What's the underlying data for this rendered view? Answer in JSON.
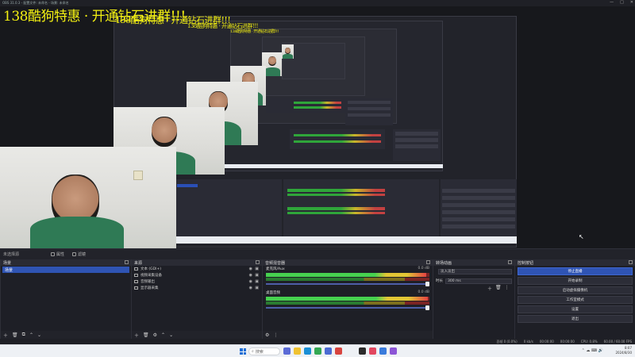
{
  "window": {
    "title": "OBS 31.0.3 - 配置文件: 未命名 - 场景: 未命名",
    "controls": [
      "—",
      "□",
      "✕"
    ]
  },
  "preview": {
    "overlay_title": "138酷狗特惠 · 开通钻石进群!!!",
    "cursor": "↖"
  },
  "scene_bar": {
    "label": "未选择源",
    "buttons": [
      {
        "label": "属性",
        "icon": "gear-icon"
      },
      {
        "label": "滤镜",
        "icon": "filter-icon"
      }
    ]
  },
  "scenes": {
    "header": "场景",
    "items": [
      "场景"
    ],
    "footer_icons": [
      "＋",
      "🗑",
      "⧉",
      "⌃",
      "⌄"
    ]
  },
  "sources": {
    "header": "来源",
    "items": [
      {
        "name": "文本 (GDI+)"
      },
      {
        "name": "视频采集设备"
      },
      {
        "name": "音频输出"
      },
      {
        "name": "显示器采集"
      }
    ],
    "footer_icons": [
      "＋",
      "🗑",
      "⚙",
      "⌃",
      "⌄"
    ]
  },
  "mixer": {
    "header": "音频混音器",
    "channels": [
      {
        "name": "麦克风/Aux",
        "db": "0.0 dB",
        "level": 0.98
      },
      {
        "name": "桌面音频",
        "db": "0.0 dB",
        "level": 0.99
      }
    ],
    "footer_icons": [
      "⚙",
      "⋮"
    ]
  },
  "transitions": {
    "header": "转场动画",
    "type_value": "淡入淡出",
    "duration_label": "时长",
    "duration_value": "300 ms"
  },
  "controls": {
    "header": "控制按钮",
    "buttons": [
      {
        "label": "停止直播",
        "primary": true
      },
      {
        "label": "开始录制",
        "primary": false
      },
      {
        "label": "启动虚拟摄像机",
        "primary": false
      },
      {
        "label": "工作室模式",
        "primary": false
      },
      {
        "label": "设置",
        "primary": false
      },
      {
        "label": "退出",
        "primary": false
      }
    ]
  },
  "status": {
    "frames": "丢帧 0 (0.0%)",
    "kbps": "0 kb/s",
    "live": "00:00:00",
    "rec": "00:00:00",
    "cpu": "CPU: 0.8%",
    "fps": "60.00 / 60.00 FPS"
  },
  "taskbar": {
    "search_placeholder": "搜索",
    "time": "8:07",
    "date": "2024/8/30",
    "apps": [
      {
        "name": "task-view",
        "color": "#5b6bd6"
      },
      {
        "name": "file-explorer",
        "color": "#f0c231"
      },
      {
        "name": "edge",
        "color": "#1a8fd6"
      },
      {
        "name": "chrome",
        "color": "#34a853"
      },
      {
        "name": "store",
        "color": "#4b6bd3"
      },
      {
        "name": "app-red",
        "color": "#d8443f"
      },
      {
        "name": "obs",
        "color": "#2b2b2b"
      },
      {
        "name": "app-pink",
        "color": "#e2475f"
      },
      {
        "name": "app-blue",
        "color": "#3a7bdc"
      },
      {
        "name": "app-purple",
        "color": "#8c55d6"
      }
    ]
  }
}
